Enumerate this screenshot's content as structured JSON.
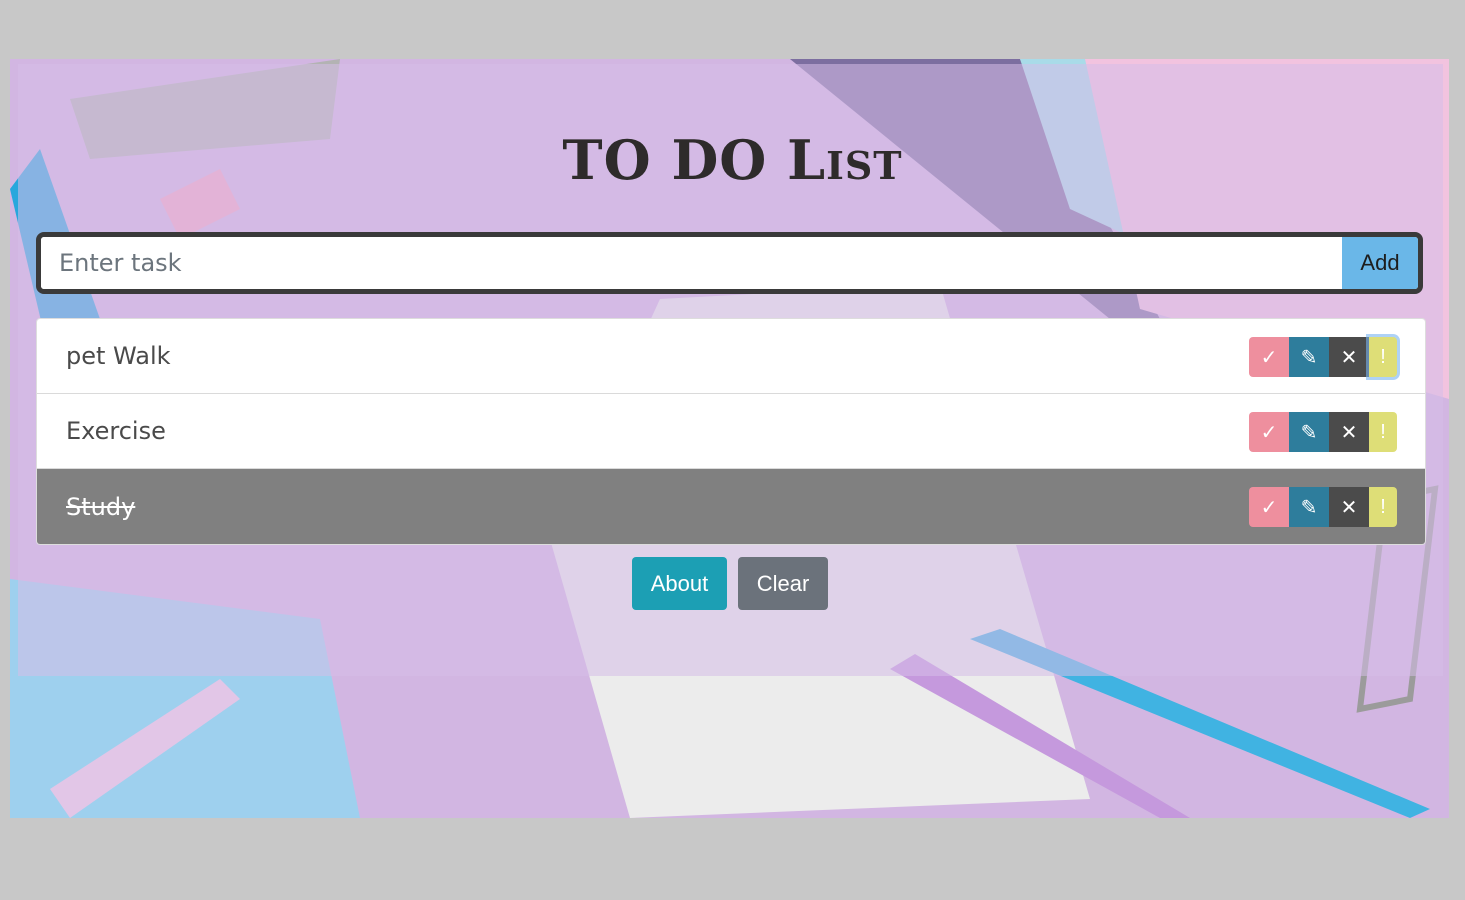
{
  "title": "TO DO List",
  "form": {
    "placeholder": "Enter task",
    "add_label": "Add"
  },
  "tasks": [
    {
      "text": "pet Walk",
      "done": false
    },
    {
      "text": "Exercise",
      "done": false
    },
    {
      "text": "Study",
      "done": true
    }
  ],
  "actions": {
    "check": "✓",
    "edit": "✎",
    "delete": "✕",
    "important": "!"
  },
  "footer": {
    "about_label": "About",
    "clear_label": "Clear"
  },
  "colors": {
    "check": "#ee8f9e",
    "edit": "#2e7d9c",
    "delete": "#4b4b4b",
    "important": "#dede77",
    "add": "#6ab7e8",
    "about": "#1c9fb4",
    "clear": "#6b727b"
  }
}
